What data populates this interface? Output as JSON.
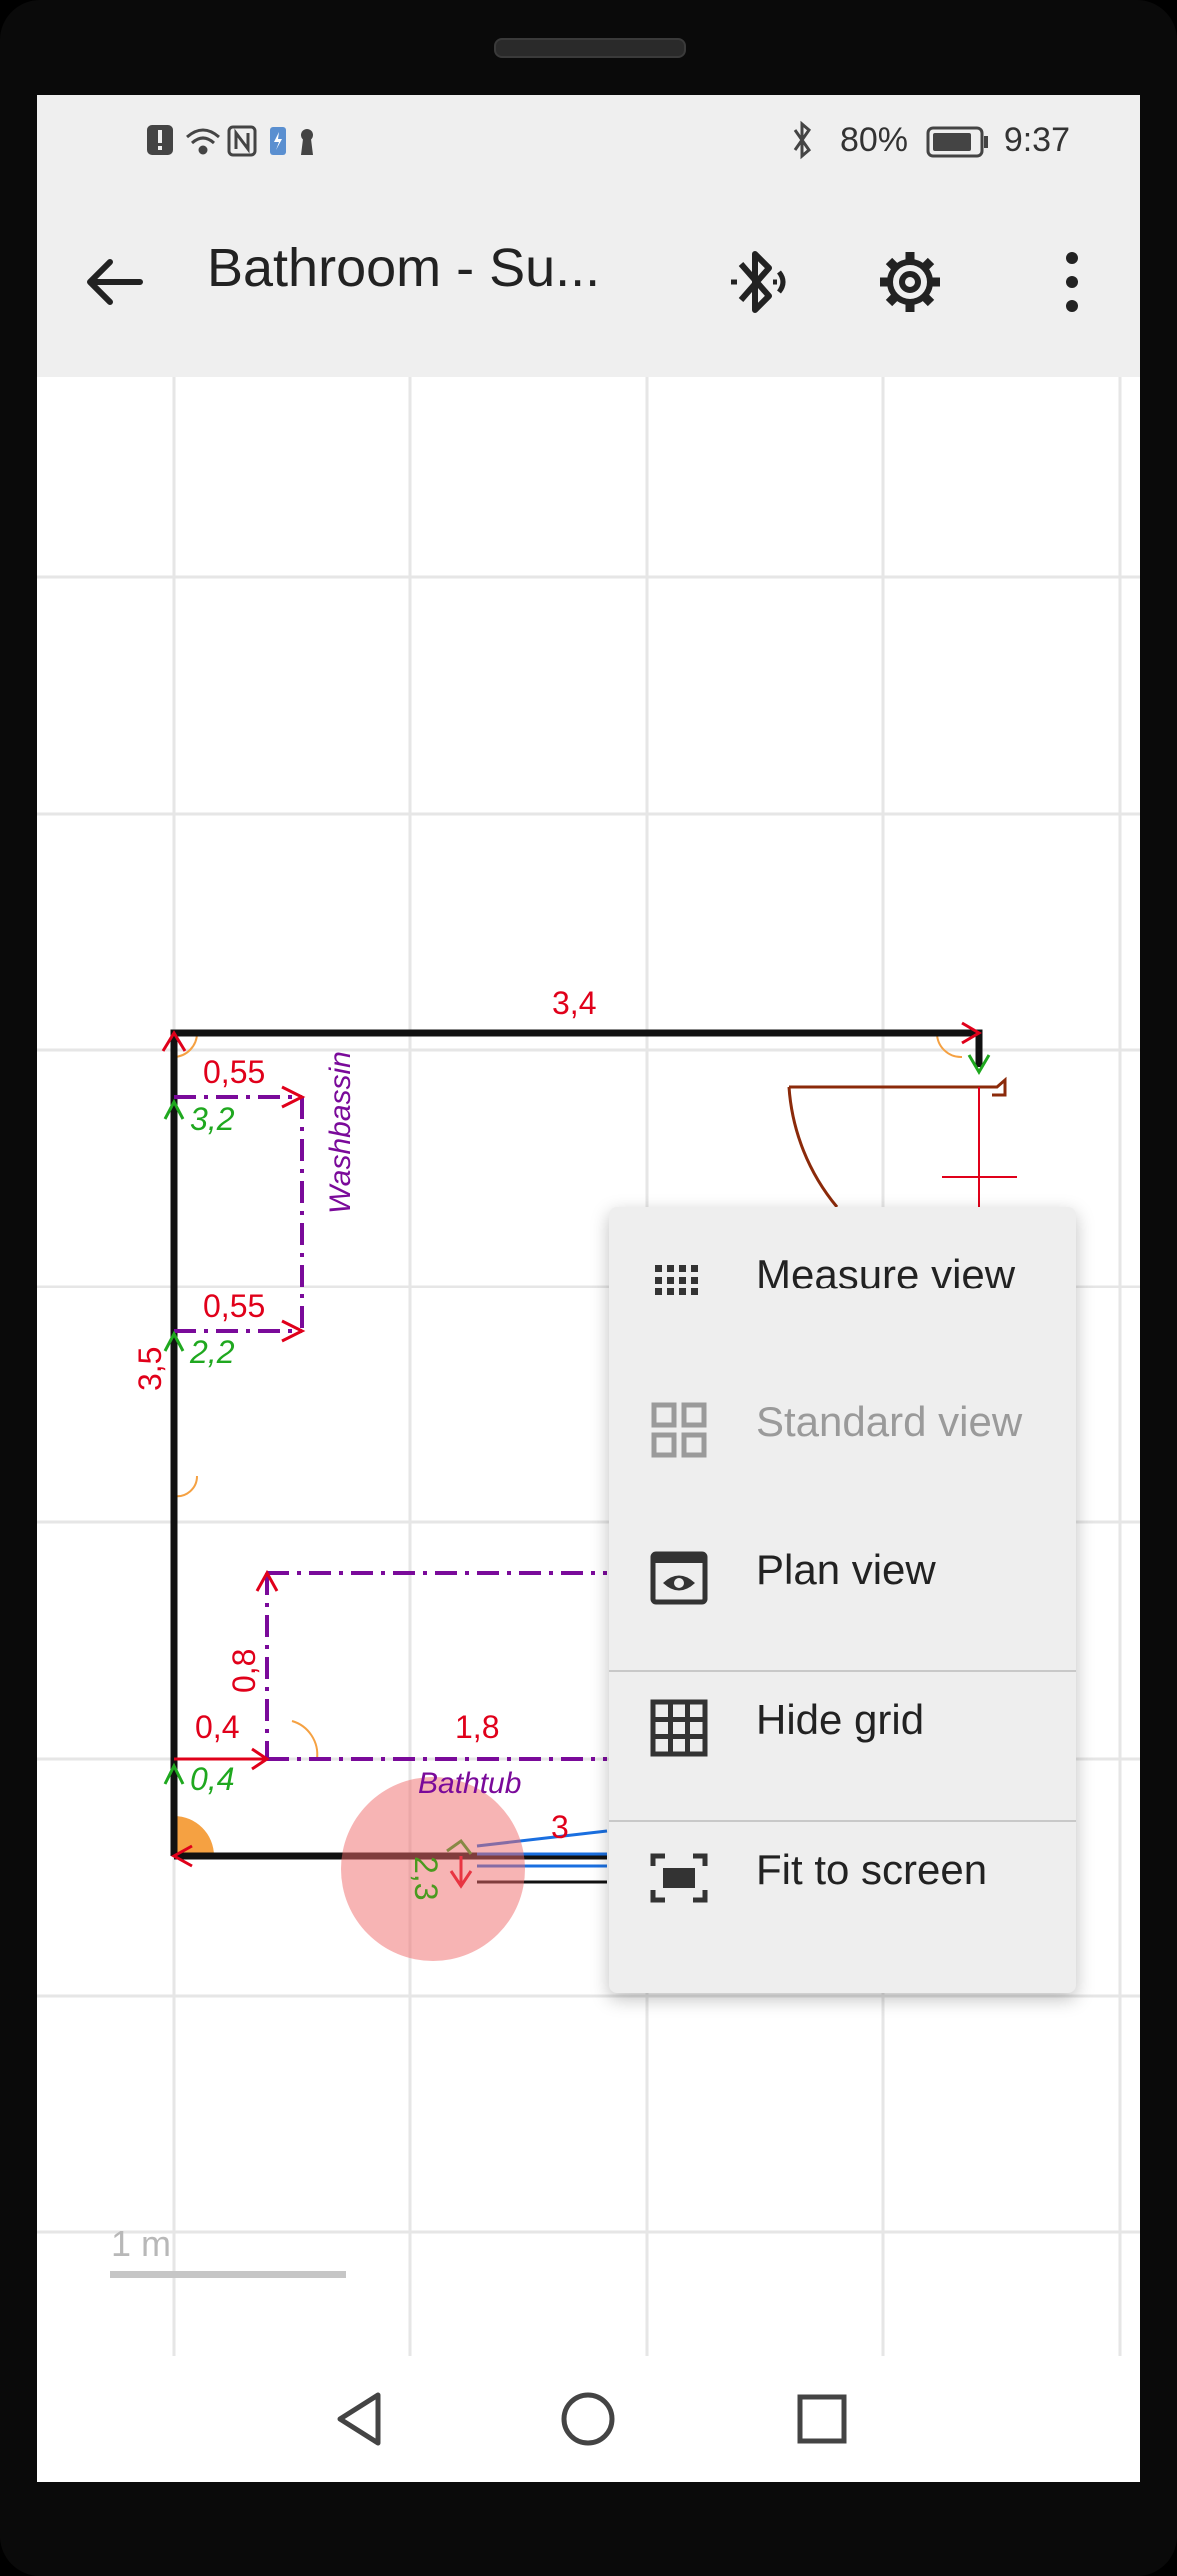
{
  "statusbar": {
    "battery": "80%",
    "time": "9:37"
  },
  "appbar": {
    "title": "Bathroom - Su..."
  },
  "canvas": {
    "labels": {
      "top_width": "3,4",
      "wb_top": "0,55",
      "wb_top_green": "3,2",
      "wb_bottom": "0,55",
      "wb_bottom_green": "2,2",
      "washbassin": "Washbassin",
      "left_height": "3,5",
      "bathtub_height": "0,8",
      "bathtub_offset": "0,4",
      "bathtub_offset_green": "0,4",
      "bathtub_width": "1,8",
      "bathtub": "Bathtub",
      "bottom_partial": "3",
      "bottom_green": "2,3",
      "scale": "1 m"
    }
  },
  "menu": {
    "items": [
      {
        "label": "Measure view",
        "icon": "dots-grid-icon",
        "enabled": true
      },
      {
        "label": "Standard view",
        "icon": "dashboard-grid-icon",
        "enabled": false
      },
      {
        "label": "Plan view",
        "icon": "eye-view-icon",
        "enabled": true
      },
      {
        "label": "Hide grid",
        "icon": "grid-icon",
        "enabled": true
      },
      {
        "label": "Fit to screen",
        "icon": "fit-screen-icon",
        "enabled": true
      }
    ]
  },
  "colors": {
    "measure_red": "#e0001a",
    "angle_green": "#1fa81f",
    "object_purple": "#7a0a9a",
    "door_brown": "#8b2a0a"
  }
}
